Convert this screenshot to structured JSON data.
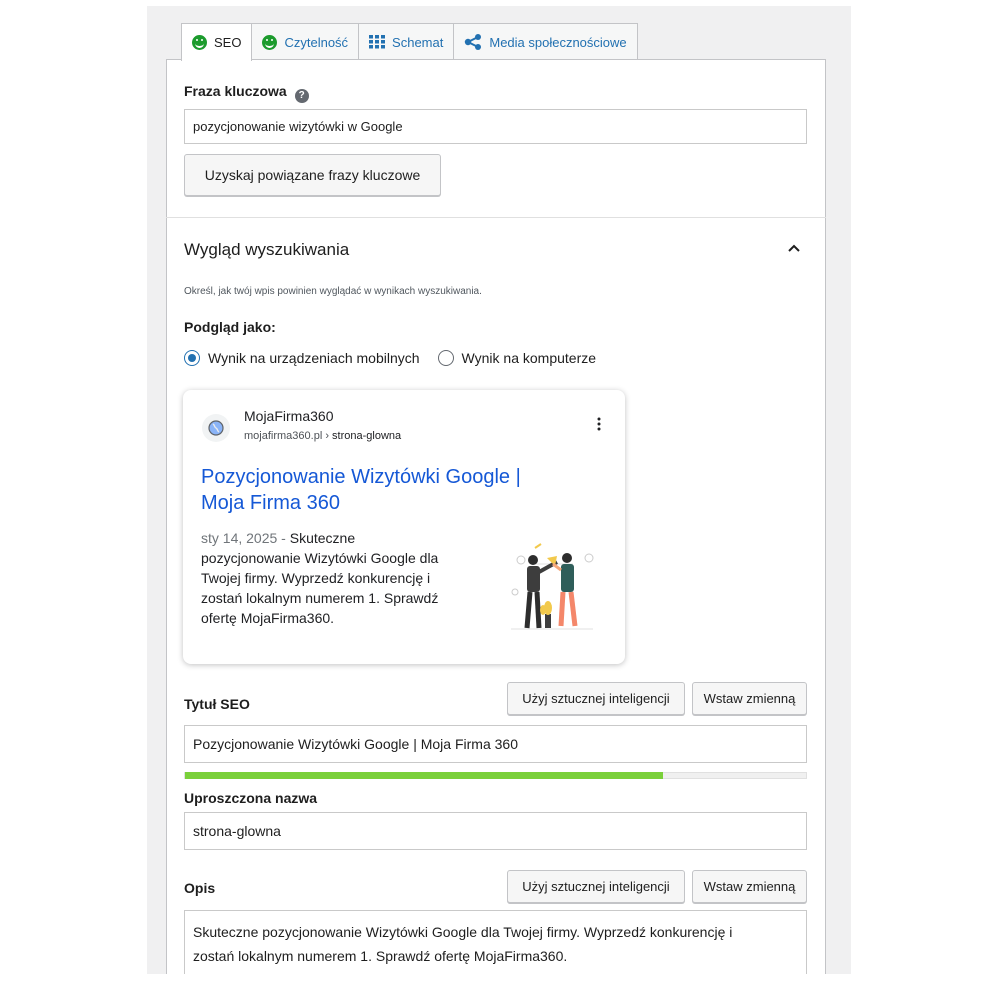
{
  "tabs": [
    {
      "label": "SEO",
      "icon": "smiley-icon"
    },
    {
      "label": "Czytelność",
      "icon": "smiley-icon"
    },
    {
      "label": "Schemat",
      "icon": "grid-icon"
    },
    {
      "label": "Media społecznościowe",
      "icon": "share-icon"
    }
  ],
  "keyphrase": {
    "label": "Fraza kluczowa",
    "help_icon": "question-icon",
    "value": "pozycjonowanie wizytówki w Google",
    "related_button": "Uzyskaj powiązane frazy kluczowe"
  },
  "search_appearance": {
    "title": "Wygląd wyszukiwania",
    "collapse_icon": "chevron-up-icon",
    "description": "Określ, jak twój wpis powinien wyglądać w wynikach wyszukiwania.",
    "preview_label": "Podgląd jako:",
    "options": [
      {
        "label": "Wynik na urządzeniach mobilnych",
        "selected": true
      },
      {
        "label": "Wynik na komputerze",
        "selected": false
      }
    ]
  },
  "preview": {
    "site_name": "MojaFirma360",
    "site_url": "mojafirma360.pl",
    "breadcrumb_sep": " › ",
    "breadcrumb": "strona-glowna",
    "menu_icon": "kebab-icon",
    "title_line1": "Pozycjonowanie Wizytówki Google |",
    "title_line2": "Moja Firma 360",
    "date": "sty 14, 2025",
    "date_sep": " - ",
    "snippet_first": "Skuteczne",
    "snippet_lines": [
      "pozycjonowanie Wizytówki Google dla",
      "Twojej firmy. Wyprzedź konkurencję i",
      "zostań lokalnym numerem 1. Sprawdź",
      "ofertę MojaFirma360."
    ]
  },
  "seo_title": {
    "label": "Tytuł SEO",
    "ai_button": "Użyj sztucznej inteligencji",
    "variable_button": "Wstaw zmienną",
    "value": "Pozycjonowanie Wizytówki Google | Moja Firma 360",
    "progress": 0.77,
    "progress_color": "#7ad03a"
  },
  "slug": {
    "label": "Uproszczona nazwa",
    "value": "strona-glowna"
  },
  "meta_description": {
    "label": "Opis",
    "ai_button": "Użyj sztucznej inteligencji",
    "variable_button": "Wstaw zmienną",
    "value_line1": "Skuteczne pozycjonowanie Wizytówki Google dla Twojej firmy. Wyprzedź konkurencję i",
    "value_line2": "zostań lokalnym numerem 1. Sprawdź ofertę MojaFirma360."
  },
  "colors": {
    "link": "#2271b1",
    "serp_title": "#1a0dab",
    "smiley_green": "#1c9b2d"
  }
}
